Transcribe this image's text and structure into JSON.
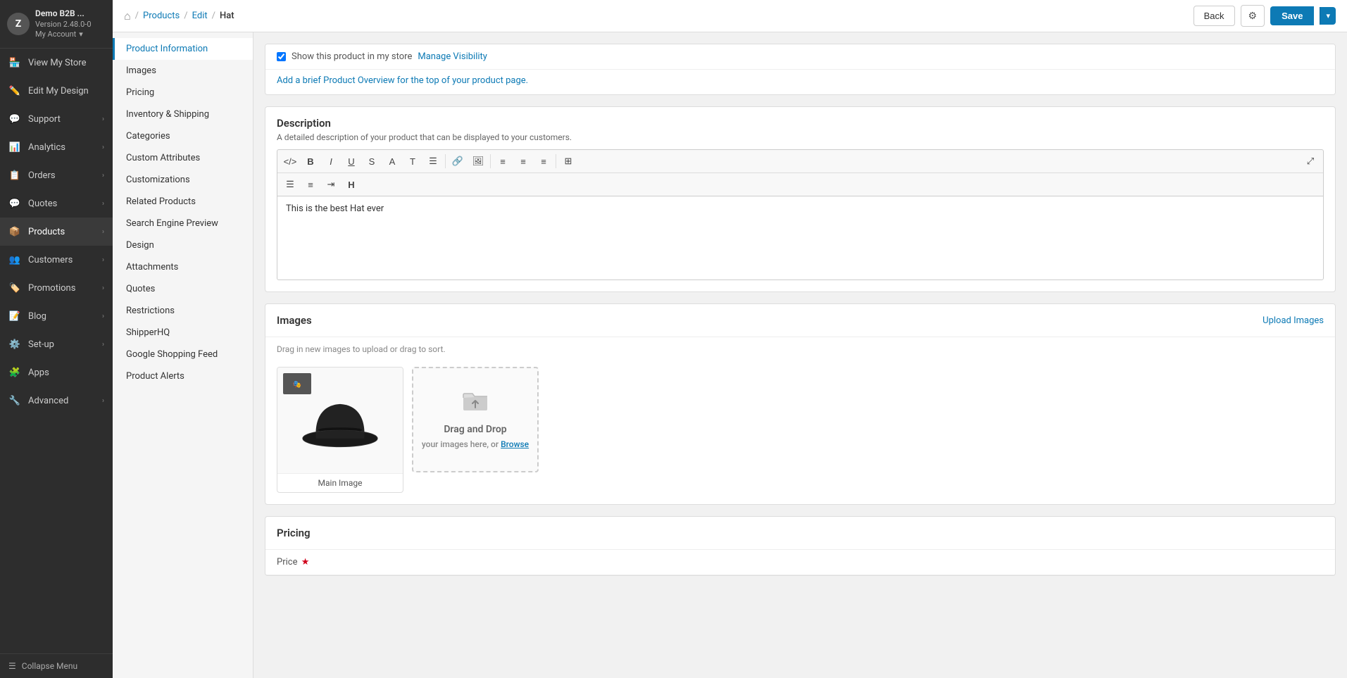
{
  "app": {
    "name": "Demo B2B ...",
    "version": "Version 2.48.0-0",
    "account": "My Account",
    "avatar_letter": "Z"
  },
  "sidebar": {
    "items": [
      {
        "id": "view-store",
        "label": "View My Store",
        "icon": "store-icon",
        "has_chevron": false
      },
      {
        "id": "edit-design",
        "label": "Edit My Design",
        "icon": "design-icon",
        "has_chevron": false
      },
      {
        "id": "support",
        "label": "Support",
        "icon": "support-icon",
        "has_chevron": true
      },
      {
        "id": "analytics",
        "label": "Analytics",
        "icon": "analytics-icon",
        "has_chevron": true
      },
      {
        "id": "orders",
        "label": "Orders",
        "icon": "orders-icon",
        "has_chevron": true
      },
      {
        "id": "quotes",
        "label": "Quotes",
        "icon": "quotes-icon",
        "has_chevron": true
      },
      {
        "id": "products",
        "label": "Products",
        "icon": "products-icon",
        "has_chevron": true,
        "active": true
      },
      {
        "id": "customers",
        "label": "Customers",
        "icon": "customers-icon",
        "has_chevron": true
      },
      {
        "id": "promotions",
        "label": "Promotions",
        "icon": "promotions-icon",
        "has_chevron": true
      },
      {
        "id": "blog",
        "label": "Blog",
        "icon": "blog-icon",
        "has_chevron": true
      },
      {
        "id": "set-up",
        "label": "Set-up",
        "icon": "setup-icon",
        "has_chevron": true
      },
      {
        "id": "apps",
        "label": "Apps",
        "icon": "apps-icon",
        "has_chevron": false
      },
      {
        "id": "advanced",
        "label": "Advanced",
        "icon": "advanced-icon",
        "has_chevron": true
      }
    ],
    "collapse_label": "Collapse Menu"
  },
  "topbar": {
    "breadcrumb": {
      "home_label": "🏠",
      "separator": "/",
      "products_label": "Products",
      "edit_label": "Edit",
      "page_label": "Hat"
    },
    "back_label": "Back",
    "save_label": "Save"
  },
  "left_nav": {
    "items": [
      {
        "id": "product-information",
        "label": "Product Information",
        "active": true
      },
      {
        "id": "images",
        "label": "Images"
      },
      {
        "id": "pricing",
        "label": "Pricing"
      },
      {
        "id": "inventory-shipping",
        "label": "Inventory & Shipping"
      },
      {
        "id": "categories",
        "label": "Categories"
      },
      {
        "id": "custom-attributes",
        "label": "Custom Attributes"
      },
      {
        "id": "customizations",
        "label": "Customizations"
      },
      {
        "id": "related-products",
        "label": "Related Products"
      },
      {
        "id": "search-engine-preview",
        "label": "Search Engine Preview"
      },
      {
        "id": "design",
        "label": "Design"
      },
      {
        "id": "attachments",
        "label": "Attachments"
      },
      {
        "id": "quotes",
        "label": "Quotes"
      },
      {
        "id": "restrictions",
        "label": "Restrictions"
      },
      {
        "id": "shipperhq",
        "label": "ShipperHQ"
      },
      {
        "id": "google-shopping-feed",
        "label": "Google Shopping Feed"
      },
      {
        "id": "product-alerts",
        "label": "Product Alerts"
      }
    ]
  },
  "main": {
    "show_in_store": {
      "checked": true,
      "label": "Show this product in my store",
      "manage_link": "Manage Visibility"
    },
    "product_overview_link": "Add a brief Product Overview for the top of your product page.",
    "description": {
      "title": "Description",
      "subtitle": "A detailed description of your product that can be displayed to your customers.",
      "content": "This is the best Hat ever",
      "toolbar_buttons": [
        {
          "id": "code",
          "symbol": "</>",
          "title": "Code"
        },
        {
          "id": "bold",
          "symbol": "B",
          "title": "Bold"
        },
        {
          "id": "italic",
          "symbol": "I",
          "title": "Italic"
        },
        {
          "id": "underline",
          "symbol": "U",
          "title": "Underline"
        },
        {
          "id": "strikethrough",
          "symbol": "S̶",
          "title": "Strikethrough"
        },
        {
          "id": "font-color",
          "symbol": "A",
          "title": "Font Color"
        },
        {
          "id": "text-format",
          "symbol": "T",
          "title": "Text Format"
        },
        {
          "id": "list",
          "symbol": "≡",
          "title": "List"
        },
        {
          "id": "link",
          "symbol": "🔗",
          "title": "Link"
        },
        {
          "id": "image",
          "symbol": "🖼",
          "title": "Image"
        },
        {
          "id": "align-left",
          "symbol": "⬡",
          "title": "Align Left"
        },
        {
          "id": "align-center",
          "symbol": "⬡",
          "title": "Align Center"
        },
        {
          "id": "align-right",
          "symbol": "⬡",
          "title": "Align Right"
        },
        {
          "id": "table",
          "symbol": "⊞",
          "title": "Table"
        }
      ],
      "toolbar2_buttons": [
        {
          "id": "unordered-list",
          "symbol": "≣",
          "title": "Unordered List"
        },
        {
          "id": "ordered-list",
          "symbol": "≡",
          "title": "Ordered List"
        },
        {
          "id": "indent",
          "symbol": "⇥",
          "title": "Indent"
        },
        {
          "id": "heading",
          "symbol": "H",
          "title": "Heading"
        }
      ]
    },
    "images": {
      "title": "Images",
      "upload_link": "Upload Images",
      "drag_hint": "Drag in new images to upload or drag to sort.",
      "main_image_label": "Main Image",
      "drag_drop_text": "Drag and Drop",
      "drag_drop_sub": "your images here, or",
      "browse_label": "Browse"
    },
    "pricing": {
      "title": "Pricing",
      "price_label": "Price",
      "required": true
    }
  }
}
